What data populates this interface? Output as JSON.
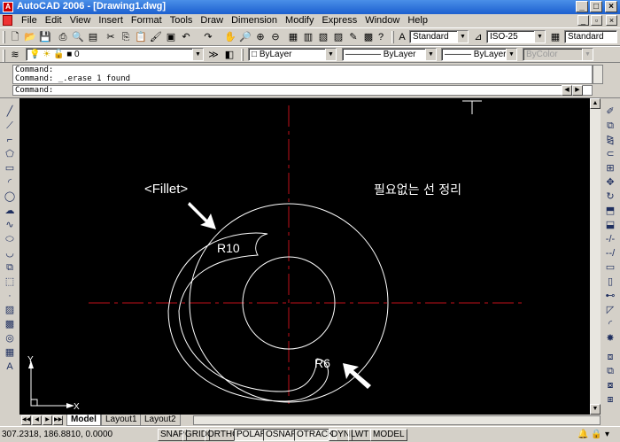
{
  "window": {
    "title": "AutoCAD 2006 - [Drawing1.dwg]",
    "minimize": "_",
    "maximize": "□",
    "close": "×"
  },
  "menu": {
    "items": [
      "File",
      "Edit",
      "View",
      "Insert",
      "Format",
      "Tools",
      "Draw",
      "Dimension",
      "Modify",
      "Express",
      "Window",
      "Help"
    ]
  },
  "toolbar1": {
    "text_style": "Standard",
    "dim_style": "ISO-25",
    "table_style": "Standard"
  },
  "toolbar2": {
    "layer": "0",
    "color": "ByLayer",
    "linetype": "ByLayer",
    "lineweight": "ByLayer",
    "plotstyle": "ByColor"
  },
  "command": {
    "history": [
      "Command:",
      "Command: _.erase 1 found"
    ],
    "prompt": "Command:"
  },
  "drawing": {
    "annotation_fillet": "<Fillet>",
    "annotation_note": "필요없는 선 정리",
    "label_r10": "R10",
    "label_r6": "R6",
    "ucs_x": "X",
    "ucs_y": "Y",
    "colors": {
      "background": "#000000",
      "geometry": "#ffffff",
      "centerline": "#c0101a"
    }
  },
  "tabs": [
    "Model",
    "Layout1",
    "Layout2"
  ],
  "status": {
    "coords": "307.2318, 186.8810, 0.0000",
    "buttons": [
      "SNAP",
      "GRID",
      "ORTHO",
      "POLAR",
      "OSNAP",
      "OTRACK",
      "DYN",
      "LWT",
      "MODEL"
    ]
  }
}
